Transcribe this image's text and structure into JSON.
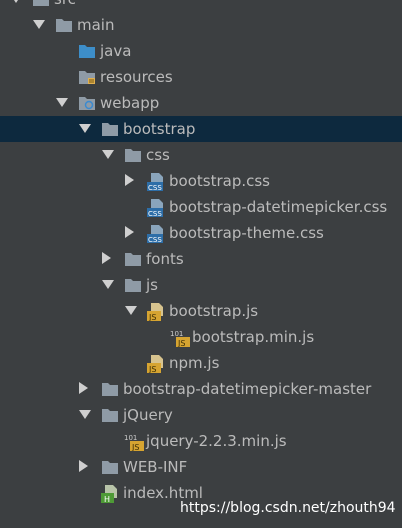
{
  "tree": [
    {
      "label": "src",
      "depth": 0,
      "arrow": "open",
      "icon": "folder"
    },
    {
      "label": "main",
      "depth": 1,
      "arrow": "open",
      "icon": "folder"
    },
    {
      "label": "java",
      "depth": 2,
      "arrow": "none",
      "icon": "source-folder"
    },
    {
      "label": "resources",
      "depth": 2,
      "arrow": "none",
      "icon": "resources-folder"
    },
    {
      "label": "webapp",
      "depth": 2,
      "arrow": "open",
      "icon": "web-folder"
    },
    {
      "label": "bootstrap",
      "depth": 3,
      "arrow": "open",
      "icon": "folder",
      "selected": true
    },
    {
      "label": "css",
      "depth": 4,
      "arrow": "open",
      "icon": "folder"
    },
    {
      "label": "bootstrap.css",
      "depth": 5,
      "arrow": "closed",
      "icon": "css-file"
    },
    {
      "label": "bootstrap-datetimepicker.css",
      "depth": 5,
      "arrow": "none",
      "icon": "css-file"
    },
    {
      "label": "bootstrap-theme.css",
      "depth": 5,
      "arrow": "closed",
      "icon": "css-file"
    },
    {
      "label": "fonts",
      "depth": 4,
      "arrow": "closed",
      "icon": "folder"
    },
    {
      "label": "js",
      "depth": 4,
      "arrow": "open",
      "icon": "folder"
    },
    {
      "label": "bootstrap.js",
      "depth": 5,
      "arrow": "open",
      "icon": "js-file"
    },
    {
      "label": "bootstrap.min.js",
      "depth": 6,
      "arrow": "none",
      "icon": "min-js-file"
    },
    {
      "label": "npm.js",
      "depth": 5,
      "arrow": "none",
      "icon": "js-file"
    },
    {
      "label": "bootstrap-datetimepicker-master",
      "depth": 3,
      "arrow": "closed",
      "icon": "folder"
    },
    {
      "label": "jQuery",
      "depth": 3,
      "arrow": "open",
      "icon": "folder"
    },
    {
      "label": "jquery-2.2.3.min.js",
      "depth": 4,
      "arrow": "none",
      "icon": "min-js-file"
    },
    {
      "label": "WEB-INF",
      "depth": 3,
      "arrow": "closed",
      "icon": "folder"
    },
    {
      "label": "index.html",
      "depth": 3,
      "arrow": "none",
      "icon": "html-file"
    }
  ],
  "watermark": "https://blog.csdn.net/zhouth94"
}
